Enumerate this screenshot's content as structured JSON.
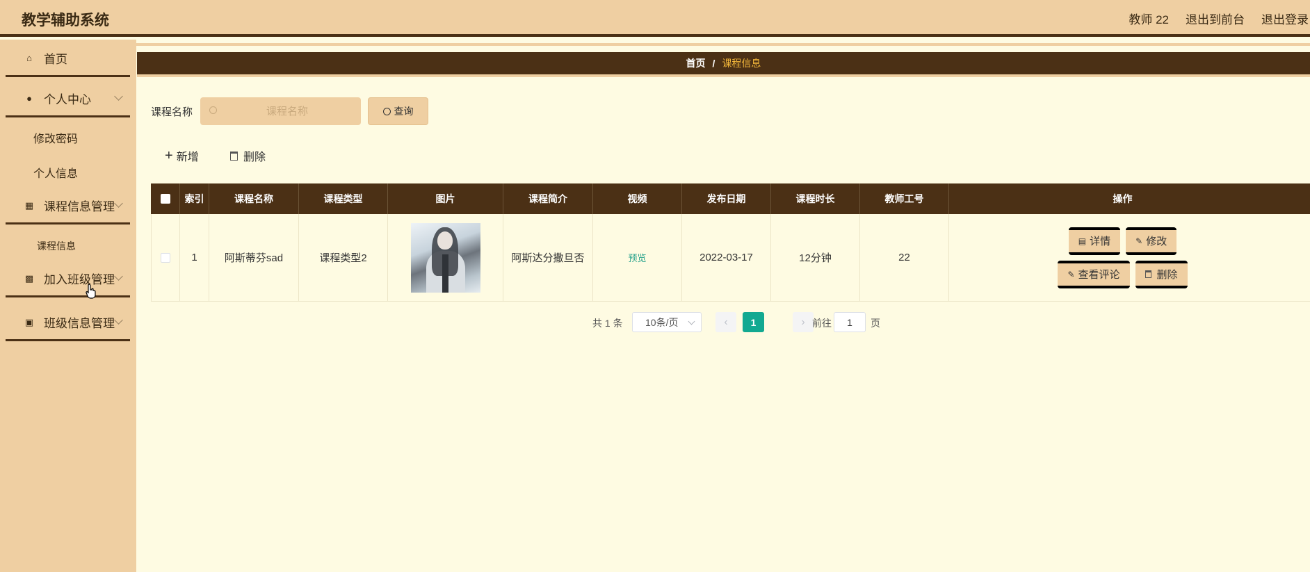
{
  "header": {
    "title": "教学辅助系统",
    "links": [
      "教师 22",
      "退出到前台",
      "退出登录"
    ]
  },
  "sidebar": {
    "home": "首页",
    "personal_center": "个人中心",
    "change_password": "修改密码",
    "personal_info": "个人信息",
    "course_mgmt": "课程信息管理",
    "course_info": "课程信息",
    "join_class_mgmt": "加入班级管理",
    "class_info_mgmt": "班级信息管理"
  },
  "breadcrumb": {
    "home": "首页",
    "sep": "/",
    "current": "课程信息"
  },
  "search": {
    "label": "课程名称",
    "placeholder": "课程名称",
    "query_label": "查询"
  },
  "toolbar": {
    "add_label": "新增",
    "delete_label": "删除"
  },
  "table": {
    "headers": [
      "索引",
      "课程名称",
      "课程类型",
      "图片",
      "课程简介",
      "视频",
      "发布日期",
      "课程时长",
      "教师工号",
      "操作"
    ],
    "rows": [
      {
        "index": "1",
        "course_name": "阿斯蒂芬sad",
        "course_type": "课程类型2",
        "intro": "阿斯达分撒旦否",
        "video": "预览",
        "publish_date": "2022-03-17",
        "duration": "12分钟",
        "teacher_id": "22"
      }
    ],
    "actions": {
      "detail": "详情",
      "edit": "修改",
      "comments": "查看评论",
      "delete": "删除"
    }
  },
  "pagination": {
    "total": "共 1 条",
    "page_size": "10条/页",
    "current_page": "1",
    "goto_label": "前往",
    "goto_value": "1",
    "page_suffix": "页"
  }
}
